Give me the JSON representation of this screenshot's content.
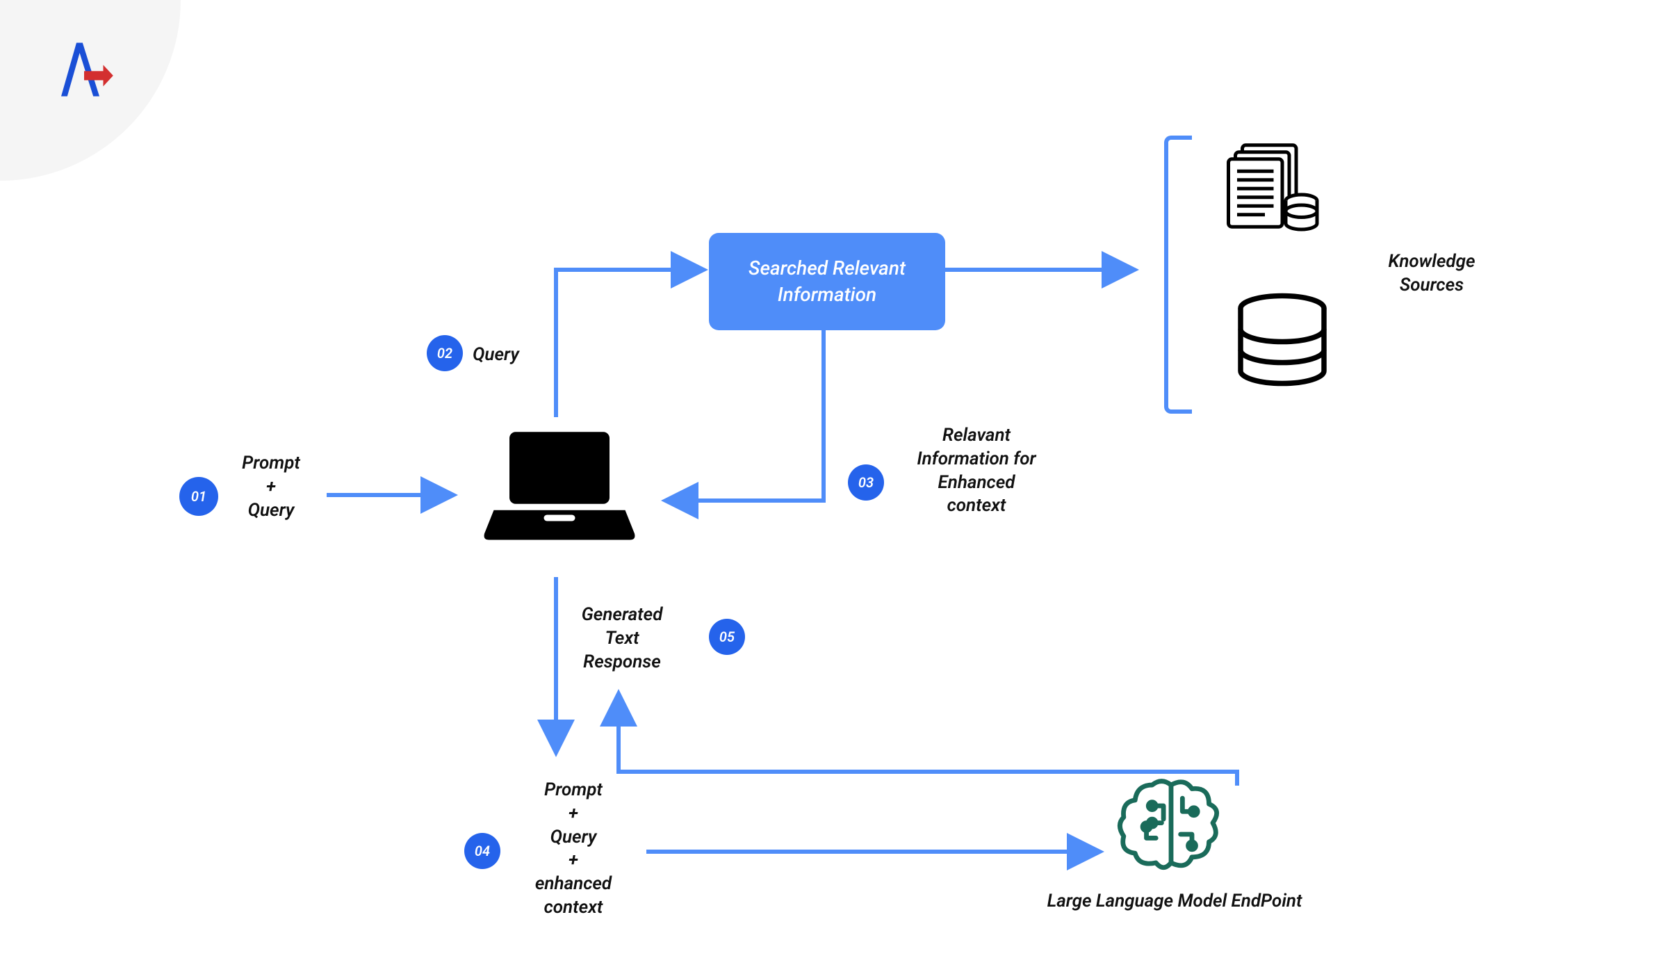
{
  "colors": {
    "accent": "#4f8df9",
    "badge": "#2563eb",
    "text": "#111111",
    "logoBlue": "#1a4fd6",
    "logoRed": "#d32f2f",
    "brainGreen": "#1a6b5a"
  },
  "logo": {
    "name": "logo-a-arrow"
  },
  "steps": {
    "s01": {
      "num": "01",
      "label": "Prompt\n+\nQuery"
    },
    "s02": {
      "num": "02",
      "label": "Query"
    },
    "s03": {
      "num": "03",
      "label": "Relavant\nInformation for\nEnhanced\ncontext"
    },
    "s04": {
      "num": "04",
      "label": "Prompt\n+\nQuery\n+\nenhanced\ncontext"
    },
    "s05": {
      "num": "05",
      "label": "Generated\nText\nResponse"
    }
  },
  "nodes": {
    "searchedInfo": "Searched Relevant\nInformation",
    "knowledgeSources": "Knowledge\nSources",
    "llmEndpoint": "Large Language Model EndPoint"
  },
  "icons": {
    "laptop": "laptop-icon",
    "documents": "documents-db-icon",
    "database": "database-icon",
    "brain": "brain-circuit-icon"
  }
}
